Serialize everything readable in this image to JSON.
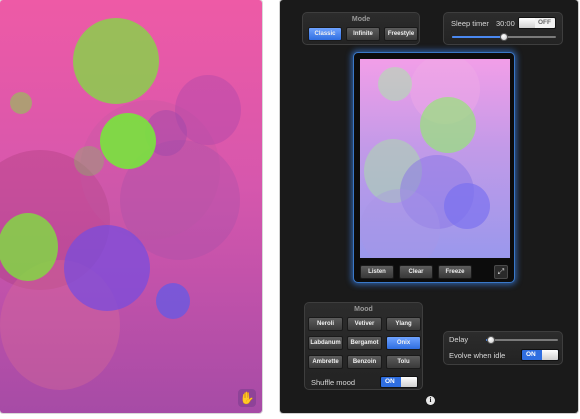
{
  "mode": {
    "title": "Mode",
    "options": [
      "Classic",
      "Infinite",
      "Freestyle"
    ],
    "selected": "Classic"
  },
  "sleep_timer": {
    "label": "Sleep timer",
    "time": "30:00",
    "toggle": "OFF",
    "slider_fraction": 0.5
  },
  "preview": {
    "buttons": [
      "Listen",
      "Clear",
      "Freeze"
    ],
    "expand_icon": "expand-icon"
  },
  "mood": {
    "title": "Mood",
    "options": [
      [
        "Neroli",
        "Vetiver",
        "Ylang"
      ],
      [
        "Labdanum",
        "Bergamot",
        "Onix"
      ],
      [
        "Ambrette",
        "Benzoin",
        "Tolu"
      ]
    ],
    "selected": "Onix",
    "shuffle_label": "Shuffle mood",
    "shuffle_toggle": "ON"
  },
  "idle": {
    "delay_label": "Delay",
    "delay_fraction": 0.06,
    "evolve_label": "Evolve when idle",
    "evolve_toggle": "ON"
  },
  "icons": {
    "hand": "hand-icon",
    "info": "info-icon"
  },
  "colors": {
    "accent_blue": "#2f6ee0",
    "art_pink": "#ee5aa6",
    "art_purple": "#a64ba6",
    "circle_green": "#7ee03f",
    "circle_violet": "#7a4cdc"
  }
}
